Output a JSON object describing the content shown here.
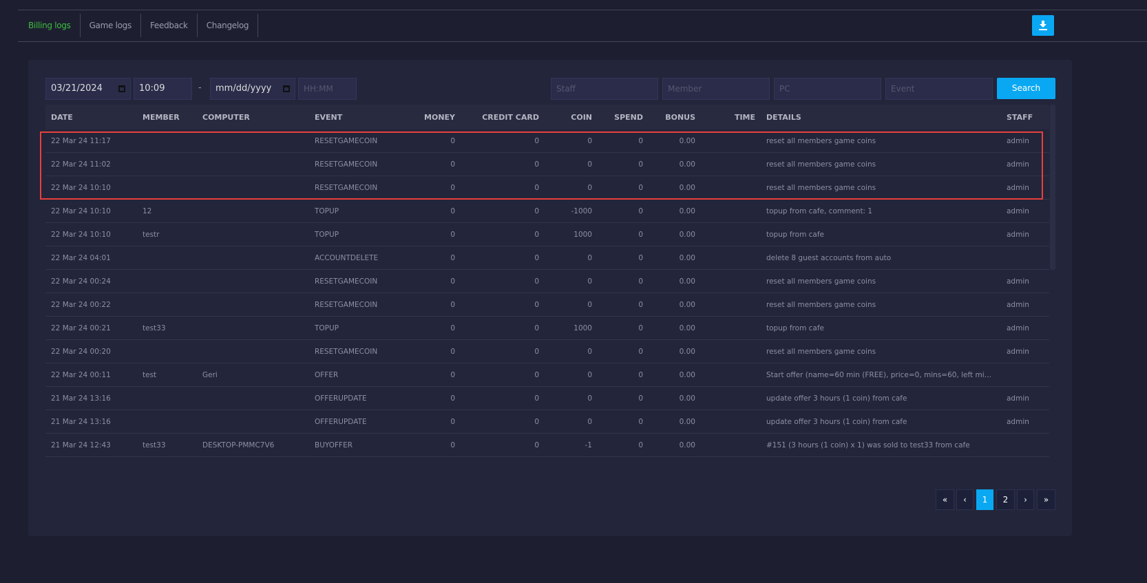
{
  "tabs": [
    {
      "label": "Billing logs",
      "active": true
    },
    {
      "label": "Game logs"
    },
    {
      "label": "Feedback"
    },
    {
      "label": "Changelog"
    }
  ],
  "download_icon": "download-icon",
  "filters": {
    "date_from": "03/21/2024",
    "time_from": "10:09",
    "separator": "-",
    "date_to_placeholder": "mm/dd/yyyy",
    "time_to_placeholder": "HH:MM",
    "staff_placeholder": "Staff",
    "member_placeholder": "Member",
    "pc_placeholder": "PC",
    "event_placeholder": "Event",
    "search_label": "Search"
  },
  "columns": [
    "DATE",
    "MEMBER",
    "COMPUTER",
    "EVENT",
    "MONEY",
    "CREDIT CARD",
    "COIN",
    "SPEND",
    "BONUS",
    "TIME",
    "DETAILS",
    "STAFF"
  ],
  "rows": [
    [
      "22 Mar 24 11:17",
      "",
      "",
      "RESETGAMECOIN",
      "0",
      "0",
      "0",
      "0",
      "0.00",
      "",
      "reset all members game coins",
      "admin"
    ],
    [
      "22 Mar 24 11:02",
      "",
      "",
      "RESETGAMECOIN",
      "0",
      "0",
      "0",
      "0",
      "0.00",
      "",
      "reset all members game coins",
      "admin"
    ],
    [
      "22 Mar 24 10:10",
      "",
      "",
      "RESETGAMECOIN",
      "0",
      "0",
      "0",
      "0",
      "0.00",
      "",
      "reset all members game coins",
      "admin"
    ],
    [
      "22 Mar 24 10:10",
      "12",
      "",
      "TOPUP",
      "0",
      "0",
      "-1000",
      "0",
      "0.00",
      "",
      "topup from cafe, comment: 1",
      "admin"
    ],
    [
      "22 Mar 24 10:10",
      "testr",
      "",
      "TOPUP",
      "0",
      "0",
      "1000",
      "0",
      "0.00",
      "",
      "topup from cafe",
      "admin"
    ],
    [
      "22 Mar 24 04:01",
      "",
      "",
      "ACCOUNTDELETE",
      "0",
      "0",
      "0",
      "0",
      "0.00",
      "",
      "delete 8 guest accounts from auto",
      ""
    ],
    [
      "22 Mar 24 00:24",
      "",
      "",
      "RESETGAMECOIN",
      "0",
      "0",
      "0",
      "0",
      "0.00",
      "",
      "reset all members game coins",
      "admin"
    ],
    [
      "22 Mar 24 00:22",
      "",
      "",
      "RESETGAMECOIN",
      "0",
      "0",
      "0",
      "0",
      "0.00",
      "",
      "reset all members game coins",
      "admin"
    ],
    [
      "22 Mar 24 00:21",
      "test33",
      "",
      "TOPUP",
      "0",
      "0",
      "1000",
      "0",
      "0.00",
      "",
      "topup from cafe",
      "admin"
    ],
    [
      "22 Mar 24 00:20",
      "",
      "",
      "RESETGAMECOIN",
      "0",
      "0",
      "0",
      "0",
      "0.00",
      "",
      "reset all members game coins",
      "admin"
    ],
    [
      "22 Mar 24 00:11",
      "test",
      "Geri",
      "OFFER",
      "0",
      "0",
      "0",
      "0",
      "0.00",
      "",
      "Start offer (name=60 min (FREE), price=0, mins=60, left mins=1...",
      ""
    ],
    [
      "21 Mar 24 13:16",
      "",
      "",
      "OFFERUPDATE",
      "0",
      "0",
      "0",
      "0",
      "0.00",
      "",
      "update offer 3 hours (1 coin) from cafe",
      "admin"
    ],
    [
      "21 Mar 24 13:16",
      "",
      "",
      "OFFERUPDATE",
      "0",
      "0",
      "0",
      "0",
      "0.00",
      "",
      "update offer 3 hours (1 coin) from cafe",
      "admin"
    ],
    [
      "21 Mar 24 12:43",
      "test33",
      "DESKTOP-PMMC7V6",
      "BUYOFFER",
      "0",
      "0",
      "-1",
      "0",
      "0.00",
      "",
      "#151 (3 hours (1 coin) x 1) was sold to test33 from cafe",
      ""
    ]
  ],
  "pagination": {
    "first": "«",
    "prev": "‹",
    "pages": [
      "1",
      "2"
    ],
    "current": "1",
    "next": "›",
    "last": "»"
  },
  "colors": {
    "accent": "#0aa8f2",
    "active_tab": "#3bbf3b",
    "highlight": "#e8403c"
  }
}
